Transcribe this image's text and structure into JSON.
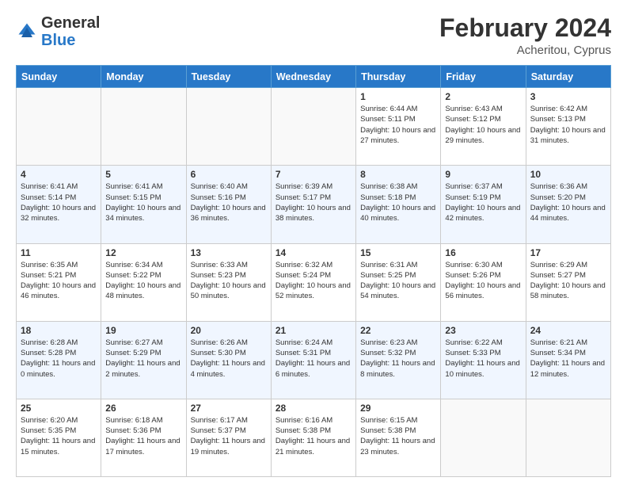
{
  "header": {
    "logo_general": "General",
    "logo_blue": "Blue",
    "month_year": "February 2024",
    "location": "Acheritou, Cyprus"
  },
  "days_of_week": [
    "Sunday",
    "Monday",
    "Tuesday",
    "Wednesday",
    "Thursday",
    "Friday",
    "Saturday"
  ],
  "weeks": [
    [
      {
        "day": "",
        "sunrise": "",
        "sunset": "",
        "daylight": "",
        "empty": true
      },
      {
        "day": "",
        "sunrise": "",
        "sunset": "",
        "daylight": "",
        "empty": true
      },
      {
        "day": "",
        "sunrise": "",
        "sunset": "",
        "daylight": "",
        "empty": true
      },
      {
        "day": "",
        "sunrise": "",
        "sunset": "",
        "daylight": "",
        "empty": true
      },
      {
        "day": "1",
        "sunrise": "Sunrise: 6:44 AM",
        "sunset": "Sunset: 5:11 PM",
        "daylight": "Daylight: 10 hours and 27 minutes."
      },
      {
        "day": "2",
        "sunrise": "Sunrise: 6:43 AM",
        "sunset": "Sunset: 5:12 PM",
        "daylight": "Daylight: 10 hours and 29 minutes."
      },
      {
        "day": "3",
        "sunrise": "Sunrise: 6:42 AM",
        "sunset": "Sunset: 5:13 PM",
        "daylight": "Daylight: 10 hours and 31 minutes."
      }
    ],
    [
      {
        "day": "4",
        "sunrise": "Sunrise: 6:41 AM",
        "sunset": "Sunset: 5:14 PM",
        "daylight": "Daylight: 10 hours and 32 minutes."
      },
      {
        "day": "5",
        "sunrise": "Sunrise: 6:41 AM",
        "sunset": "Sunset: 5:15 PM",
        "daylight": "Daylight: 10 hours and 34 minutes."
      },
      {
        "day": "6",
        "sunrise": "Sunrise: 6:40 AM",
        "sunset": "Sunset: 5:16 PM",
        "daylight": "Daylight: 10 hours and 36 minutes."
      },
      {
        "day": "7",
        "sunrise": "Sunrise: 6:39 AM",
        "sunset": "Sunset: 5:17 PM",
        "daylight": "Daylight: 10 hours and 38 minutes."
      },
      {
        "day": "8",
        "sunrise": "Sunrise: 6:38 AM",
        "sunset": "Sunset: 5:18 PM",
        "daylight": "Daylight: 10 hours and 40 minutes."
      },
      {
        "day": "9",
        "sunrise": "Sunrise: 6:37 AM",
        "sunset": "Sunset: 5:19 PM",
        "daylight": "Daylight: 10 hours and 42 minutes."
      },
      {
        "day": "10",
        "sunrise": "Sunrise: 6:36 AM",
        "sunset": "Sunset: 5:20 PM",
        "daylight": "Daylight: 10 hours and 44 minutes."
      }
    ],
    [
      {
        "day": "11",
        "sunrise": "Sunrise: 6:35 AM",
        "sunset": "Sunset: 5:21 PM",
        "daylight": "Daylight: 10 hours and 46 minutes."
      },
      {
        "day": "12",
        "sunrise": "Sunrise: 6:34 AM",
        "sunset": "Sunset: 5:22 PM",
        "daylight": "Daylight: 10 hours and 48 minutes."
      },
      {
        "day": "13",
        "sunrise": "Sunrise: 6:33 AM",
        "sunset": "Sunset: 5:23 PM",
        "daylight": "Daylight: 10 hours and 50 minutes."
      },
      {
        "day": "14",
        "sunrise": "Sunrise: 6:32 AM",
        "sunset": "Sunset: 5:24 PM",
        "daylight": "Daylight: 10 hours and 52 minutes."
      },
      {
        "day": "15",
        "sunrise": "Sunrise: 6:31 AM",
        "sunset": "Sunset: 5:25 PM",
        "daylight": "Daylight: 10 hours and 54 minutes."
      },
      {
        "day": "16",
        "sunrise": "Sunrise: 6:30 AM",
        "sunset": "Sunset: 5:26 PM",
        "daylight": "Daylight: 10 hours and 56 minutes."
      },
      {
        "day": "17",
        "sunrise": "Sunrise: 6:29 AM",
        "sunset": "Sunset: 5:27 PM",
        "daylight": "Daylight: 10 hours and 58 minutes."
      }
    ],
    [
      {
        "day": "18",
        "sunrise": "Sunrise: 6:28 AM",
        "sunset": "Sunset: 5:28 PM",
        "daylight": "Daylight: 11 hours and 0 minutes."
      },
      {
        "day": "19",
        "sunrise": "Sunrise: 6:27 AM",
        "sunset": "Sunset: 5:29 PM",
        "daylight": "Daylight: 11 hours and 2 minutes."
      },
      {
        "day": "20",
        "sunrise": "Sunrise: 6:26 AM",
        "sunset": "Sunset: 5:30 PM",
        "daylight": "Daylight: 11 hours and 4 minutes."
      },
      {
        "day": "21",
        "sunrise": "Sunrise: 6:24 AM",
        "sunset": "Sunset: 5:31 PM",
        "daylight": "Daylight: 11 hours and 6 minutes."
      },
      {
        "day": "22",
        "sunrise": "Sunrise: 6:23 AM",
        "sunset": "Sunset: 5:32 PM",
        "daylight": "Daylight: 11 hours and 8 minutes."
      },
      {
        "day": "23",
        "sunrise": "Sunrise: 6:22 AM",
        "sunset": "Sunset: 5:33 PM",
        "daylight": "Daylight: 11 hours and 10 minutes."
      },
      {
        "day": "24",
        "sunrise": "Sunrise: 6:21 AM",
        "sunset": "Sunset: 5:34 PM",
        "daylight": "Daylight: 11 hours and 12 minutes."
      }
    ],
    [
      {
        "day": "25",
        "sunrise": "Sunrise: 6:20 AM",
        "sunset": "Sunset: 5:35 PM",
        "daylight": "Daylight: 11 hours and 15 minutes."
      },
      {
        "day": "26",
        "sunrise": "Sunrise: 6:18 AM",
        "sunset": "Sunset: 5:36 PM",
        "daylight": "Daylight: 11 hours and 17 minutes."
      },
      {
        "day": "27",
        "sunrise": "Sunrise: 6:17 AM",
        "sunset": "Sunset: 5:37 PM",
        "daylight": "Daylight: 11 hours and 19 minutes."
      },
      {
        "day": "28",
        "sunrise": "Sunrise: 6:16 AM",
        "sunset": "Sunset: 5:38 PM",
        "daylight": "Daylight: 11 hours and 21 minutes."
      },
      {
        "day": "29",
        "sunrise": "Sunrise: 6:15 AM",
        "sunset": "Sunset: 5:38 PM",
        "daylight": "Daylight: 11 hours and 23 minutes."
      },
      {
        "day": "",
        "sunrise": "",
        "sunset": "",
        "daylight": "",
        "empty": true
      },
      {
        "day": "",
        "sunrise": "",
        "sunset": "",
        "daylight": "",
        "empty": true
      }
    ]
  ]
}
